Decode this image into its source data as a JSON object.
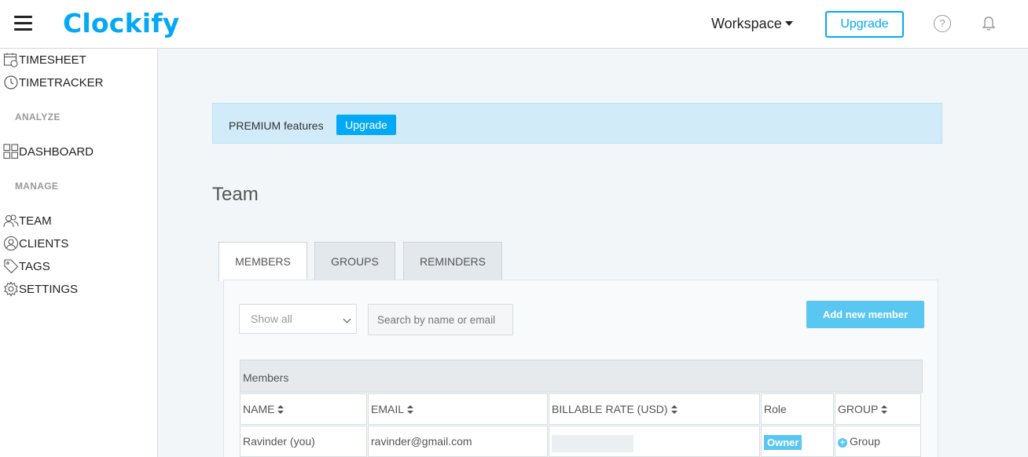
{
  "header": {
    "logo": "Clockify",
    "workspace": "Workspace",
    "upgrade": "Upgrade",
    "help_glyph": "?"
  },
  "sidebar": {
    "items_top": [
      {
        "label": "TIMESHEET",
        "icon": "timesheet-icon"
      },
      {
        "label": "TIMETRACKER",
        "icon": "clock-icon"
      }
    ],
    "section_analyze": "ANALYZE",
    "dashboard": {
      "label": "DASHBOARD",
      "icon": "dashboard-grid-icon"
    },
    "section_manage": "MANAGE",
    "items_manage": [
      {
        "label": "TEAM",
        "icon": "team-icon"
      },
      {
        "label": "CLIENTS",
        "icon": "client-icon"
      },
      {
        "label": "TAGS",
        "icon": "tag-icon"
      },
      {
        "label": "SETTINGS",
        "icon": "gear-icon"
      }
    ]
  },
  "premium": {
    "text": "PREMIUM features",
    "button": "Upgrade"
  },
  "page": {
    "title": "Team",
    "tabs": [
      "MEMBERS",
      "GROUPS",
      "REMINDERS"
    ],
    "active_tab": "MEMBERS"
  },
  "filters": {
    "show_select": "Show all",
    "search_placeholder": "Search by name or email",
    "add_button": "Add new member"
  },
  "table": {
    "title": "Members",
    "columns": [
      "NAME",
      "EMAIL",
      "BILLABLE RATE (USD)",
      "Role",
      "GROUP"
    ],
    "rows": [
      {
        "name": "Ravinder (you)",
        "email": "ravinder@gmail.com",
        "role": "Owner",
        "group": "Group"
      }
    ]
  },
  "colors": {
    "brand": "#03a9f4",
    "accent_light": "#5ac6f2",
    "banner_bg": "#d1ecf8"
  }
}
